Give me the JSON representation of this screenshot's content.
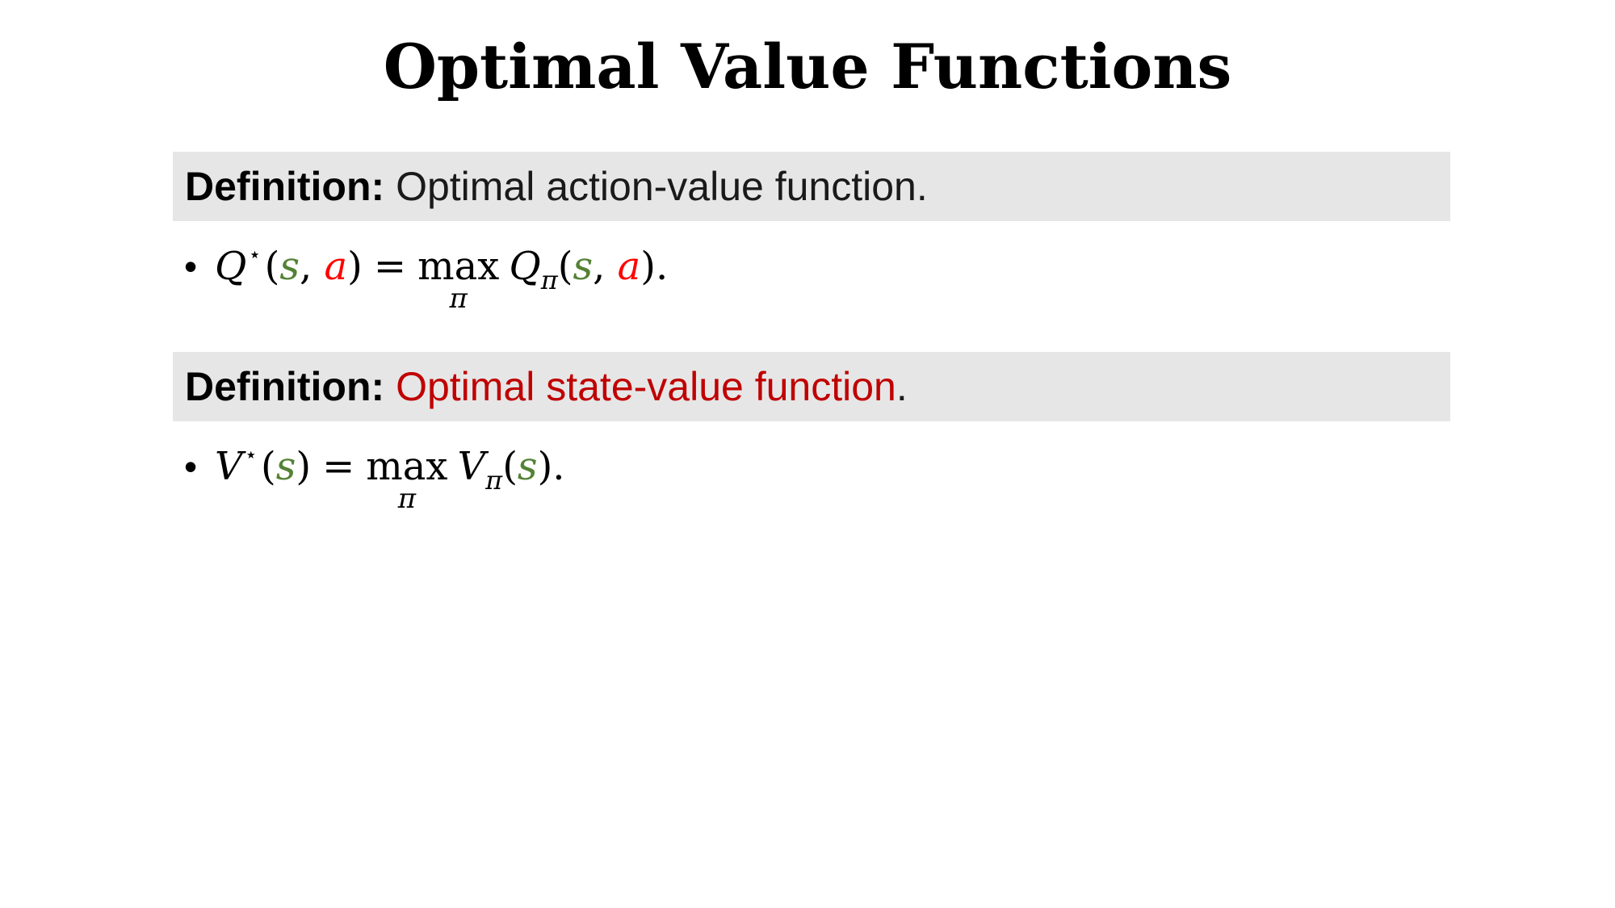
{
  "slide": {
    "title": "Optimal Value Functions"
  },
  "definitions": [
    {
      "label": "Definition:",
      "text": "Optimal action-value function.",
      "text_accent": "",
      "text_after": ""
    },
    {
      "label": "Definition:",
      "text": "",
      "text_accent": "Optimal state-value function",
      "text_after": "."
    }
  ],
  "formulas": {
    "q": {
      "bullet": "•",
      "lhs_symbol": "Q",
      "star": "⋆",
      "open": "(",
      "state": "s",
      "comma": ",",
      "action": "a",
      "close": ")",
      "equals": "=",
      "max": "max",
      "max_sub": "π",
      "rhs_symbol": "Q",
      "rhs_sub": "π",
      "end": ")."
    },
    "v": {
      "bullet": "•",
      "lhs_symbol": "V",
      "star": "⋆",
      "open": "(",
      "state": "s",
      "close": ")",
      "equals": "=",
      "max": "max",
      "max_sub": "π",
      "rhs_symbol": "V",
      "rhs_sub": "π",
      "end": ")."
    }
  },
  "colors": {
    "definition_box_bg": "#e6e6e6",
    "accent_red": "#c00000",
    "state_green": "#548235",
    "action_red": "#ff0000"
  }
}
